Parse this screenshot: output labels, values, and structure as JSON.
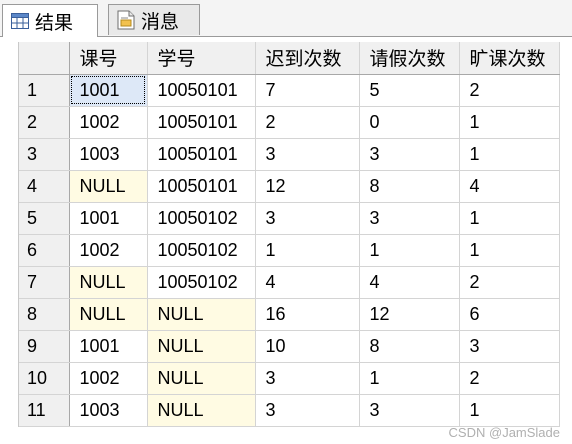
{
  "tabs": [
    {
      "label": "结果",
      "icon": "grid-icon",
      "active": true
    },
    {
      "label": "消息",
      "icon": "message-icon",
      "active": false
    }
  ],
  "grid": {
    "columns": [
      "课号",
      "学号",
      "迟到次数",
      "请假次数",
      "旷课次数"
    ],
    "rows": [
      {
        "num": "1",
        "cells": [
          "1001",
          "10050101",
          "7",
          "5",
          "2"
        ]
      },
      {
        "num": "2",
        "cells": [
          "1002",
          "10050101",
          "2",
          "0",
          "1"
        ]
      },
      {
        "num": "3",
        "cells": [
          "1003",
          "10050101",
          "3",
          "3",
          "1"
        ]
      },
      {
        "num": "4",
        "cells": [
          "NULL",
          "10050101",
          "12",
          "8",
          "4"
        ]
      },
      {
        "num": "5",
        "cells": [
          "1001",
          "10050102",
          "3",
          "3",
          "1"
        ]
      },
      {
        "num": "6",
        "cells": [
          "1002",
          "10050102",
          "1",
          "1",
          "1"
        ]
      },
      {
        "num": "7",
        "cells": [
          "NULL",
          "10050102",
          "4",
          "4",
          "2"
        ]
      },
      {
        "num": "8",
        "cells": [
          "NULL",
          "NULL",
          "16",
          "12",
          "6"
        ]
      },
      {
        "num": "9",
        "cells": [
          "1001",
          "NULL",
          "10",
          "8",
          "3"
        ]
      },
      {
        "num": "10",
        "cells": [
          "1002",
          "NULL",
          "3",
          "1",
          "2"
        ]
      },
      {
        "num": "11",
        "cells": [
          "1003",
          "NULL",
          "3",
          "3",
          "1"
        ]
      }
    ]
  },
  "watermark": "CSDN @JamSlade",
  "colors": {
    "null_cell_bg": "#fffbe3",
    "header_bg": "#f0f0f0",
    "selected_cell_bg": "#dde8f7"
  }
}
